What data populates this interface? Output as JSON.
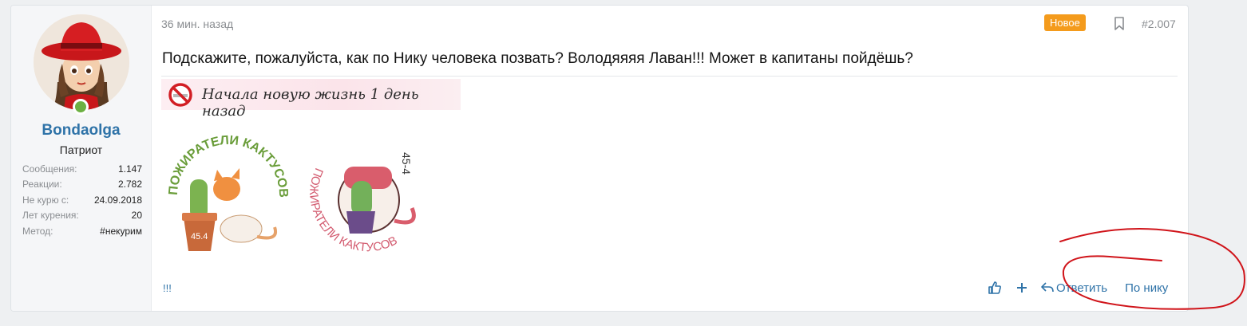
{
  "user": {
    "name": "Bondaolga",
    "title": "Патриот",
    "stats": [
      {
        "label": "Сообщения:",
        "value": "1.147"
      },
      {
        "label": "Реакции:",
        "value": "2.782"
      },
      {
        "label": "Не курю с:",
        "value": "24.09.2018"
      },
      {
        "label": "Лет курения:",
        "value": "20"
      },
      {
        "label": "Метод:",
        "value": "#некурим"
      }
    ]
  },
  "post": {
    "time": "36 мин. назад",
    "badge": "Новое",
    "number": "#2.007",
    "text": "Подскажите, пожалуйста, как по Нику человека позвать? Володяяяя Лаван!!! Может в капитаны пойдёшь?"
  },
  "signature": {
    "banner_text": "Начала новую жизнь 1 день назад",
    "sticker1_text": "ПОЖИРАТЕЛИ КАКТУСОВ",
    "sticker1_pot": "45.4",
    "sticker2_text": "ПОЖИРАТЕЛИ КАКТУСОВ",
    "sticker2_num": "45-4",
    "extra": "!!!"
  },
  "actions": {
    "reply": "Ответить",
    "mention": "По нику"
  },
  "colors": {
    "accent": "#2f73a8",
    "badge": "#f49b1c",
    "online": "#6cb043",
    "annotation": "#d0141a"
  },
  "icons": [
    "like-icon",
    "plus-icon",
    "reply-icon",
    "bookmark-icon",
    "online-icon",
    "no-smoking-icon"
  ]
}
